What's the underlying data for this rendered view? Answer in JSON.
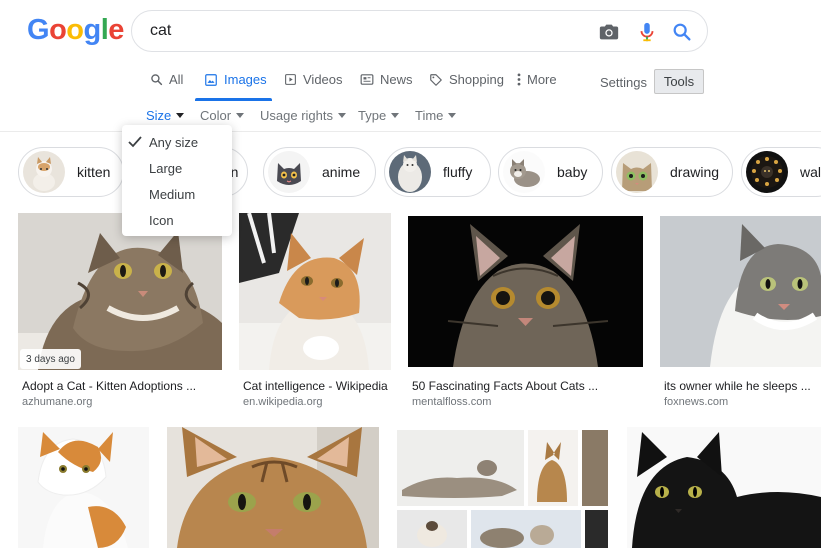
{
  "logo": {
    "letters": [
      "G",
      "o",
      "o",
      "g",
      "l",
      "e"
    ],
    "colors": [
      "#4285F4",
      "#EA4335",
      "#FBBC05",
      "#4285F4",
      "#34A853",
      "#EA4335"
    ]
  },
  "search": {
    "query": "cat"
  },
  "tabs": [
    {
      "label": "All",
      "icon": "search-icon"
    },
    {
      "label": "Images",
      "icon": "image-icon",
      "active": true
    },
    {
      "label": "Videos",
      "icon": "play-icon"
    },
    {
      "label": "News",
      "icon": "newspaper-icon"
    },
    {
      "label": "Shopping",
      "icon": "tag-icon"
    },
    {
      "label": "More",
      "icon": "kebab-icon"
    }
  ],
  "settings_label": "Settings",
  "tools_label": "Tools",
  "filters": [
    {
      "label": "Size",
      "active": true
    },
    {
      "label": "Color"
    },
    {
      "label": "Usage rights"
    },
    {
      "label": "Type"
    },
    {
      "label": "Time"
    }
  ],
  "size_menu": {
    "items": [
      "Any size",
      "Large",
      "Medium",
      "Icon"
    ],
    "selected": "Any size"
  },
  "chips": [
    {
      "label": "kitten"
    },
    {
      "label": "...n"
    },
    {
      "label": "anime"
    },
    {
      "label": "fluffy"
    },
    {
      "label": "baby"
    },
    {
      "label": "drawing"
    },
    {
      "label": "wal"
    }
  ],
  "results": [
    {
      "title": "Adopt a Cat - Kitten Adoptions ...",
      "source": "azhumane.org",
      "badge": "3 days ago"
    },
    {
      "title": "Cat intelligence - Wikipedia",
      "source": "en.wikipedia.org"
    },
    {
      "title": "50 Fascinating Facts About Cats ...",
      "source": "mentalfloss.com"
    },
    {
      "title": "its owner while he sleeps ...",
      "source": "foxnews.com"
    }
  ],
  "colors": {
    "accent": "#1a73e8",
    "muted": "#70757a"
  }
}
